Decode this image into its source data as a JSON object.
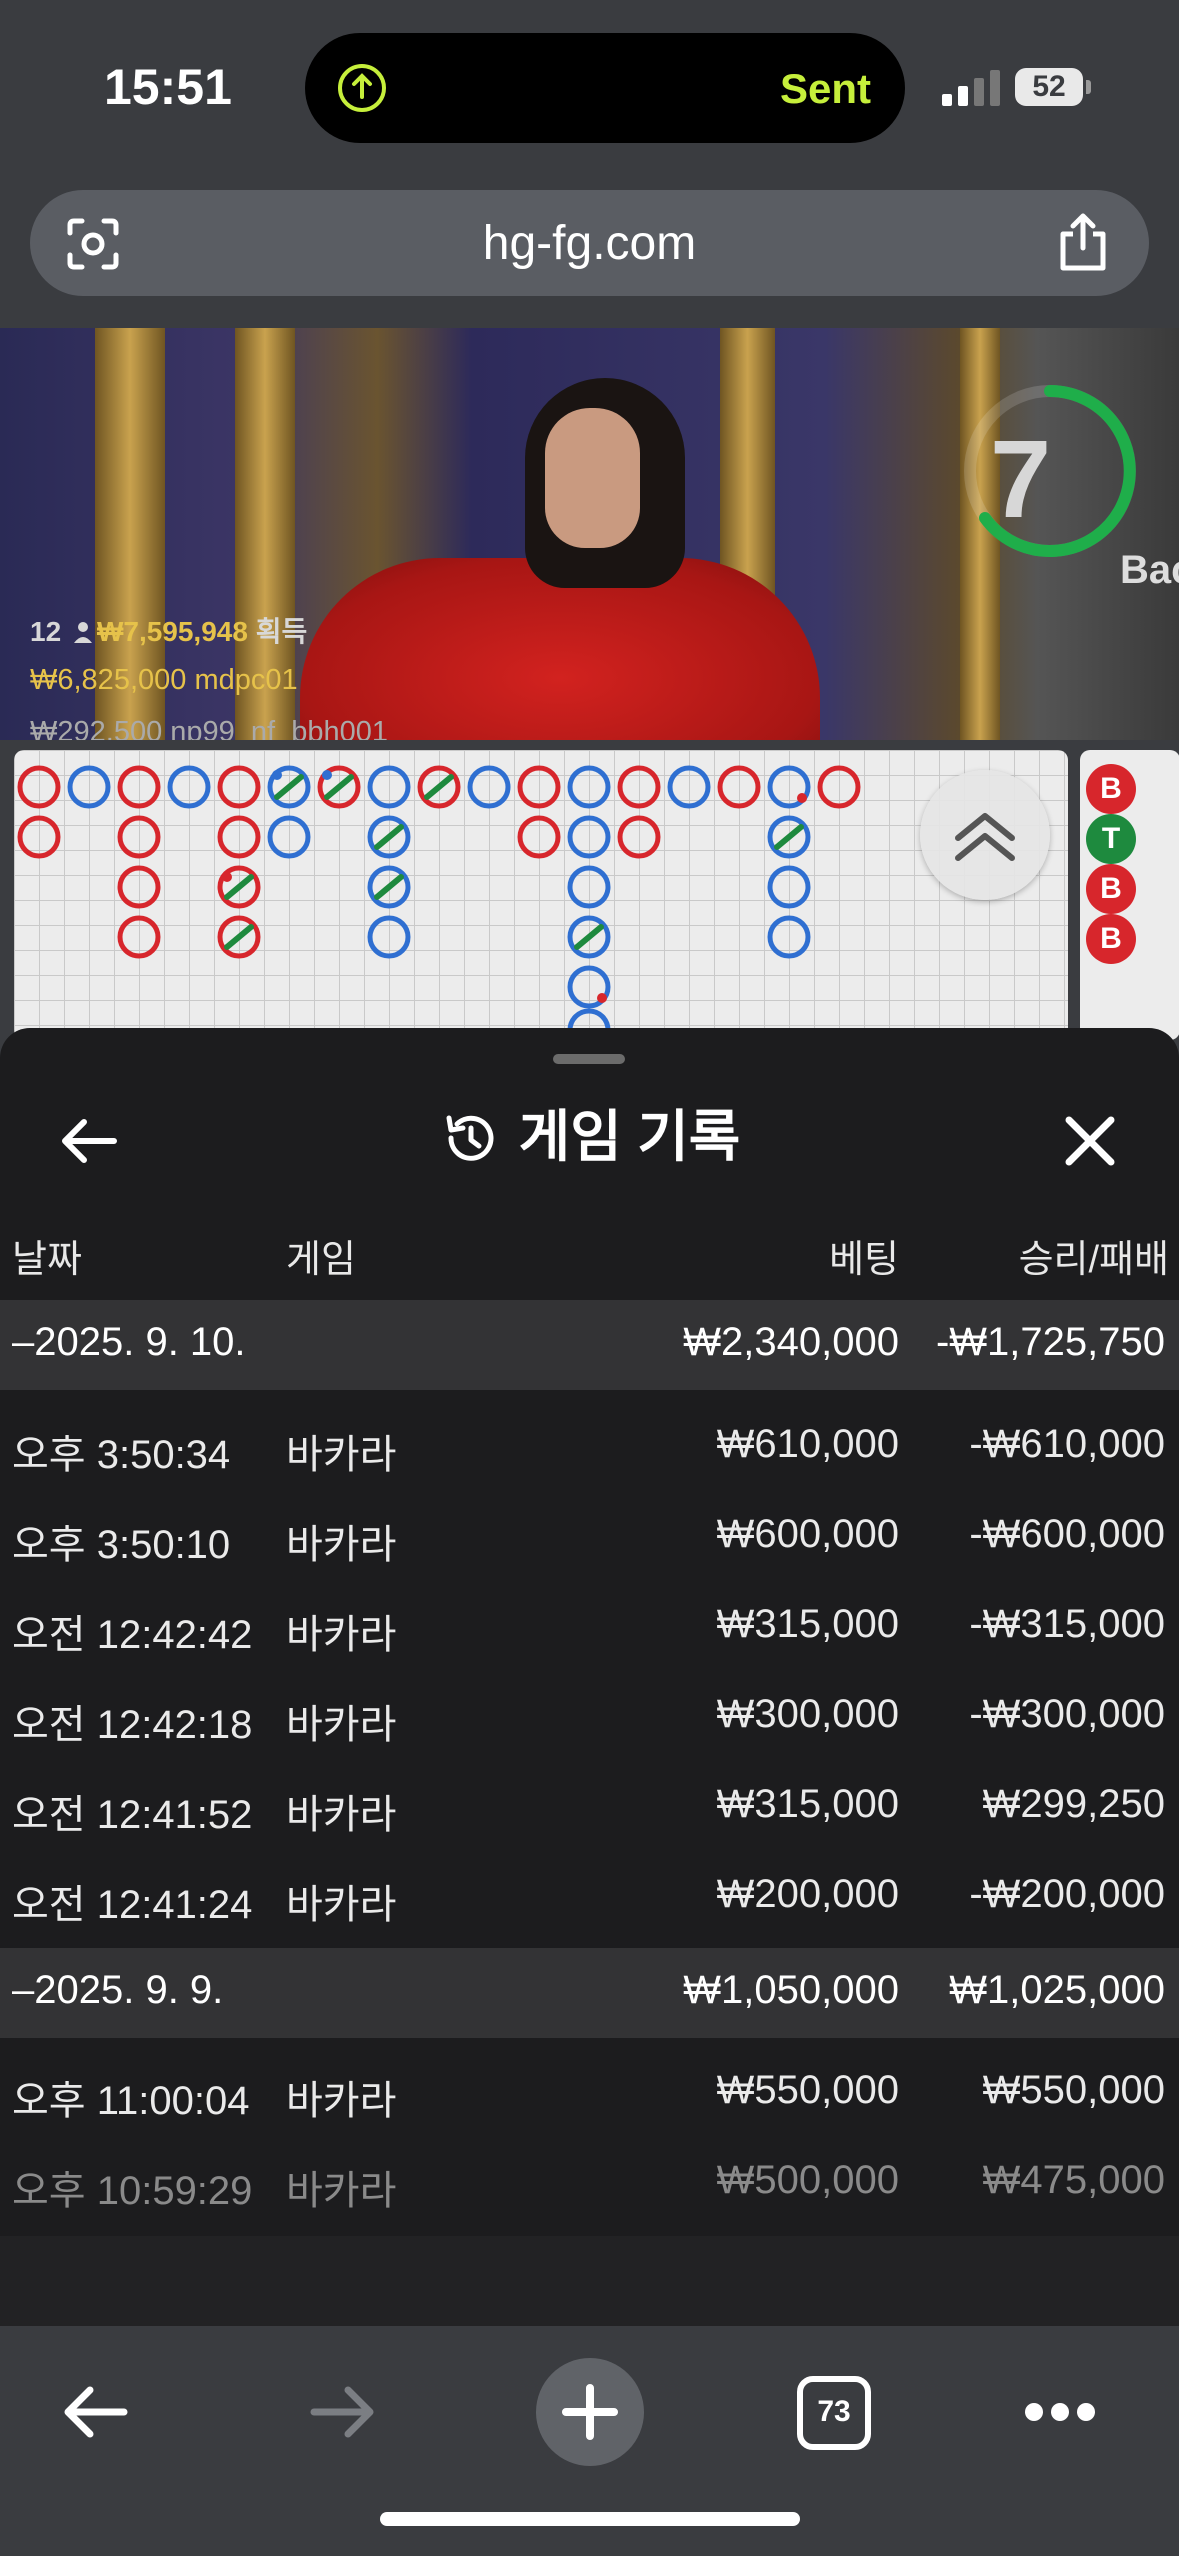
{
  "status_bar": {
    "time": "15:51",
    "activity_label": "Sent",
    "battery": "52"
  },
  "address_bar": {
    "url": "hg-fg.com"
  },
  "video": {
    "timer": "7",
    "table_sign": "Bacca",
    "winners": {
      "count": "12",
      "total": "₩7,595,948",
      "total_suffix": "획득",
      "line2_amount": "₩6,825,000",
      "line2_user": "mdpc01",
      "line3_amount": "₩292,500",
      "line3_user": "np99_nf_bbh001"
    },
    "side_beads": [
      "B",
      "T",
      "B",
      "B"
    ]
  },
  "history": {
    "title": "게임 기록",
    "columns": {
      "date": "날짜",
      "game": "게임",
      "bet": "베팅",
      "winloss": "승리/패배"
    },
    "groups": [
      {
        "date": "–2025. 9. 10.",
        "bet_total": "₩2,340,000",
        "winloss_total": "-₩1,725,750",
        "rows": [
          {
            "time": "오후 3:50:34",
            "game": "바카라",
            "bet": "₩610,000",
            "winloss": "-₩610,000"
          },
          {
            "time": "오후 3:50:10",
            "game": "바카라",
            "bet": "₩600,000",
            "winloss": "-₩600,000"
          },
          {
            "time": "오전 12:42:42",
            "game": "바카라",
            "bet": "₩315,000",
            "winloss": "-₩315,000"
          },
          {
            "time": "오전 12:42:18",
            "game": "바카라",
            "bet": "₩300,000",
            "winloss": "-₩300,000"
          },
          {
            "time": "오전 12:41:52",
            "game": "바카라",
            "bet": "₩315,000",
            "winloss": "₩299,250"
          },
          {
            "time": "오전 12:41:24",
            "game": "바카라",
            "bet": "₩200,000",
            "winloss": "-₩200,000"
          }
        ]
      },
      {
        "date": "–2025. 9. 9.",
        "bet_total": "₩1,050,000",
        "winloss_total": "₩1,025,000",
        "rows": [
          {
            "time": "오후 11:00:04",
            "game": "바카라",
            "bet": "₩550,000",
            "winloss": "₩550,000"
          },
          {
            "time": "오후 10:59:29",
            "game": "바카라",
            "bet": "₩500,000",
            "winloss": "₩475,000"
          }
        ]
      }
    ]
  },
  "toolbar": {
    "tab_count": "73"
  },
  "colors": {
    "banker": "#d7262c",
    "player": "#2f6fd1",
    "tie": "#1e8a3e",
    "accent_gold": "#e6c24a",
    "activity": "#c6ef3b"
  }
}
